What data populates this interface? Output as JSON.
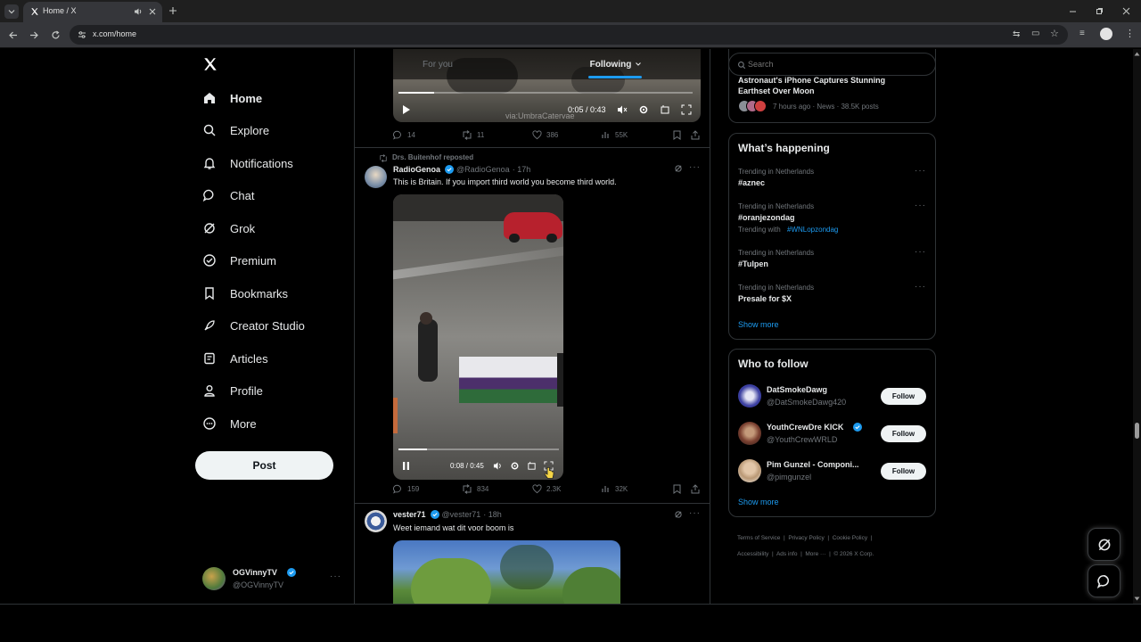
{
  "browser": {
    "tab_title": "Home / X",
    "url": "x.com/home"
  },
  "nav": {
    "items": [
      {
        "label": "Home",
        "icon": "home-icon"
      },
      {
        "label": "Explore",
        "icon": "search-icon"
      },
      {
        "label": "Notifications",
        "icon": "bell-icon"
      },
      {
        "label": "Chat",
        "icon": "chat-icon"
      },
      {
        "label": "Grok",
        "icon": "grok-icon"
      },
      {
        "label": "Premium",
        "icon": "premium-icon"
      },
      {
        "label": "Bookmarks",
        "icon": "bookmark-icon"
      },
      {
        "label": "Creator Studio",
        "icon": "rocket-icon"
      },
      {
        "label": "Articles",
        "icon": "article-icon"
      },
      {
        "label": "Profile",
        "icon": "profile-icon"
      },
      {
        "label": "More",
        "icon": "more-circle-icon"
      }
    ],
    "post_label": "Post"
  },
  "account": {
    "name": "OGVinnyTV",
    "handle": "@OGVinnyTV"
  },
  "feed": {
    "tabs": [
      {
        "label": "For you"
      },
      {
        "label": "Following"
      }
    ],
    "video1": {
      "time": "0:05 / 0:43",
      "watermark": "via:UmbraCatervae",
      "replies": "14",
      "reposts": "11",
      "likes": "386",
      "views": "55K"
    },
    "post2": {
      "repost_by": "Drs. Buitenhof reposted",
      "name": "RadioGenoa",
      "handle": "@RadioGenoa",
      "time": "· 17h",
      "text": "This is Britain. If you import third world you become third world.",
      "video_time": "0:08 / 0:45",
      "replies": "159",
      "reposts": "834",
      "likes": "2.3K",
      "views": "32K"
    },
    "post3": {
      "name": "vester71",
      "handle": "@vester71",
      "time": "· 18h",
      "text": "Weet iemand wat dit voor boom is"
    }
  },
  "search": {
    "placeholder": "Search"
  },
  "news": {
    "title": "Astronaut's iPhone Captures Stunning Earthset Over Moon",
    "meta": "7 hours ago · News · 38.5K posts"
  },
  "whats_happening": {
    "title": "What’s happening",
    "trends": [
      {
        "context": "Trending in Netherlands",
        "name": "#aznec",
        "with_label": "",
        "with_tag": ""
      },
      {
        "context": "Trending in Netherlands",
        "name": "#oranjezondag",
        "with_label": "Trending with",
        "with_tag": "#WNLopzondag"
      },
      {
        "context": "Trending in Netherlands",
        "name": "#Tulpen",
        "with_label": "",
        "with_tag": ""
      },
      {
        "context": "Trending in Netherlands",
        "name": "Presale for $X",
        "with_label": "",
        "with_tag": ""
      }
    ],
    "show_more": "Show more"
  },
  "who_to_follow": {
    "title": "Who to follow",
    "users": [
      {
        "name": "DatSmokeDawg",
        "handle": "@DatSmokeDawg420",
        "verified": false,
        "button": "Follow"
      },
      {
        "name": "YouthCrewDre KICK",
        "handle": "@YouthCrewWRLD",
        "verified": true,
        "button": "Follow"
      },
      {
        "name": "Pim Gunzel - Componi...",
        "handle": "@pimgunzel",
        "verified": false,
        "button": "Follow"
      }
    ],
    "show_more": "Show more"
  },
  "footer": {
    "links": [
      "Terms of Service",
      "Privacy Policy",
      "Cookie Policy",
      "Accessibility",
      "Ads info",
      "More ···",
      "© 2026 X Corp."
    ]
  },
  "colors": {
    "accent": "#1d9bf0",
    "background": "#000000",
    "border": "#2f3336",
    "muted": "#71767b"
  }
}
